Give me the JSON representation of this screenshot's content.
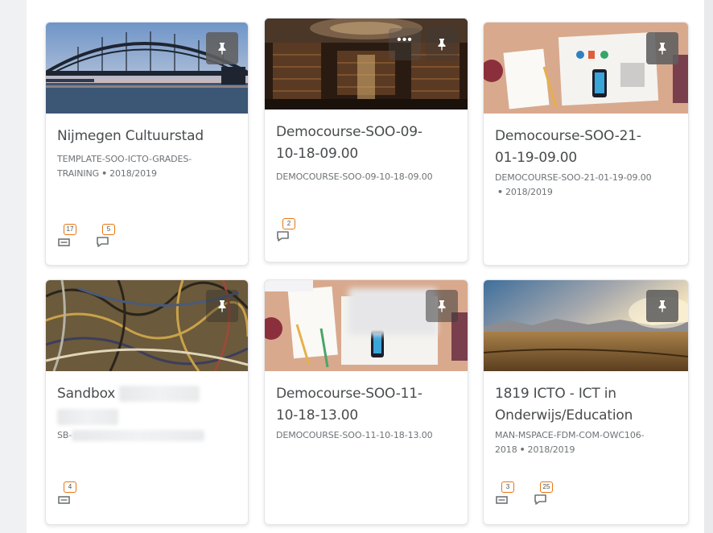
{
  "courses": [
    {
      "title": "Nijmegen Cultuurstad",
      "code": "TEMPLATE-SOO-ICTO-GRADES-TRAINING",
      "semester": "2018/2019",
      "assignments": "17",
      "discussions": "5"
    },
    {
      "title": "Democourse-SOO-09-10-18-09.00",
      "code": "DEMOCOURSE-SOO-09-10-18-09.00",
      "discussions": "2"
    },
    {
      "title": "Democourse-SOO-21-01-19-09.00",
      "code": "DEMOCOURSE-SOO-21-01-19-09.00",
      "semester": "2018/2019"
    },
    {
      "title": "Sandbox",
      "code": "SB-",
      "assignments": "4"
    },
    {
      "title": "Democourse-SOO-11-10-18-13.00",
      "code": "DEMOCOURSE-SOO-11-10-18-13.00"
    },
    {
      "title": "1819 ICTO - ICT in Onderwijs/Education",
      "code": "MAN-MSPACE-FDM-COM-OWC106-2018",
      "semester": "2018/2019",
      "assignments": "3",
      "discussions": "25"
    }
  ],
  "more_label": "•••",
  "separator": "•",
  "colors": {
    "badge_border": "#e87511",
    "title_text": "#494c4e",
    "pin_background": "#5f5f5f"
  },
  "icons": {
    "pin": "pin-icon",
    "assignment": "assignment-icon",
    "discussion": "discussion-icon",
    "more": "more-icon"
  }
}
